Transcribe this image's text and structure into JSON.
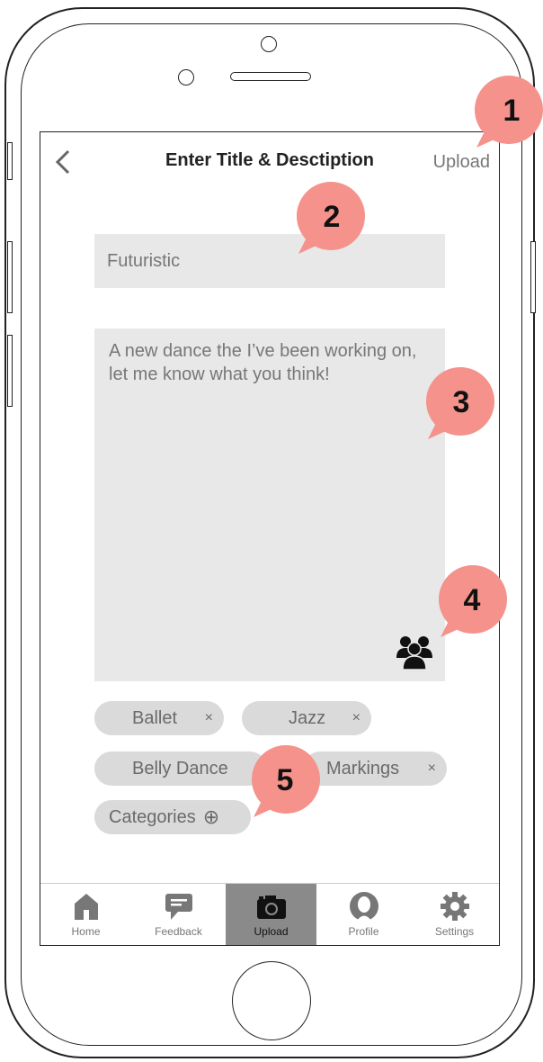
{
  "header": {
    "back_label": "<",
    "title": "Enter Title & Desctiption",
    "upload_label": "Upload"
  },
  "form": {
    "title_value": "Futuristic",
    "description_value": "A new dance the I’ve been working on, let me know what you think!"
  },
  "chips": [
    {
      "label": "Ballet",
      "close": "×"
    },
    {
      "label": "Jazz",
      "close": "×"
    },
    {
      "label": "Belly Dance",
      "close": ""
    },
    {
      "label": "Markings",
      "close": "×"
    }
  ],
  "categories": {
    "label": "Categories",
    "add_symbol": "⊕"
  },
  "tabbar": {
    "items": [
      {
        "label": "Home",
        "icon": "home-icon"
      },
      {
        "label": "Feedback",
        "icon": "feedback-icon"
      },
      {
        "label": "Upload",
        "icon": "camera-icon",
        "active": true
      },
      {
        "label": "Profile",
        "icon": "profile-icon"
      },
      {
        "label": "Settings",
        "icon": "gear-icon"
      }
    ]
  },
  "callouts": [
    "1",
    "2",
    "3",
    "4",
    "5"
  ],
  "colors": {
    "callout": "#F4928B",
    "field_bg": "#E8E8E8",
    "chip_bg": "#DADADA",
    "active_tab": "#8A8A8A"
  }
}
